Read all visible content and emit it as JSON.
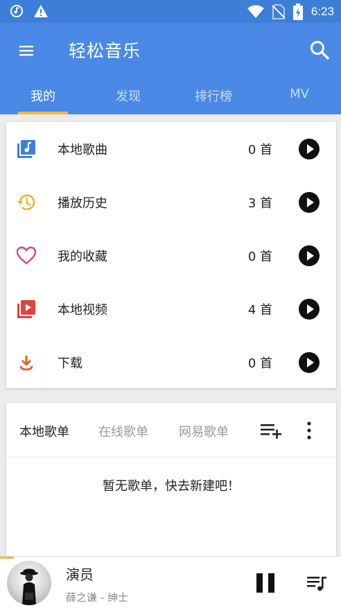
{
  "status_bar": {
    "time": "6:23",
    "left_icons": [
      "music-notification-icon",
      "warning-icon"
    ],
    "right_icons": [
      "wifi-icon",
      "no-sim-icon",
      "battery-charging-icon"
    ]
  },
  "app_bar": {
    "title": "轻松音乐",
    "menu_icon": "menu-icon",
    "search_icon": "search-icon",
    "tabs": [
      {
        "label": "我的",
        "active": true
      },
      {
        "label": "发现",
        "active": false
      },
      {
        "label": "排行榜",
        "active": false
      },
      {
        "label": "MV",
        "active": false
      }
    ]
  },
  "library": {
    "items": [
      {
        "label": "本地歌曲",
        "count": "0 首",
        "icon": "music-library-icon",
        "color": "#3f7fd6"
      },
      {
        "label": "播放历史",
        "count": "3 首",
        "icon": "history-icon",
        "color": "#f2b324"
      },
      {
        "label": "我的收藏",
        "count": "0 首",
        "icon": "heart-icon",
        "color": "#d8457a"
      },
      {
        "label": "本地视频",
        "count": "4 首",
        "icon": "video-library-icon",
        "color": "#e0443e"
      },
      {
        "label": "下载",
        "count": "0 首",
        "icon": "download-icon",
        "color": "#e8612c"
      }
    ]
  },
  "playlists": {
    "tabs": [
      {
        "label": "本地歌单",
        "active": true
      },
      {
        "label": "在线歌单",
        "active": false
      },
      {
        "label": "网易歌单",
        "active": false
      }
    ],
    "empty_text": "暂无歌单，快去新建吧！"
  },
  "player": {
    "title": "演员",
    "artist": "薛之谦 - 绅士",
    "progress": 0.04
  },
  "colors": {
    "primary": "#4a8ae6",
    "status_bar": "#3d7fd8",
    "accent": "#f4b63f"
  }
}
